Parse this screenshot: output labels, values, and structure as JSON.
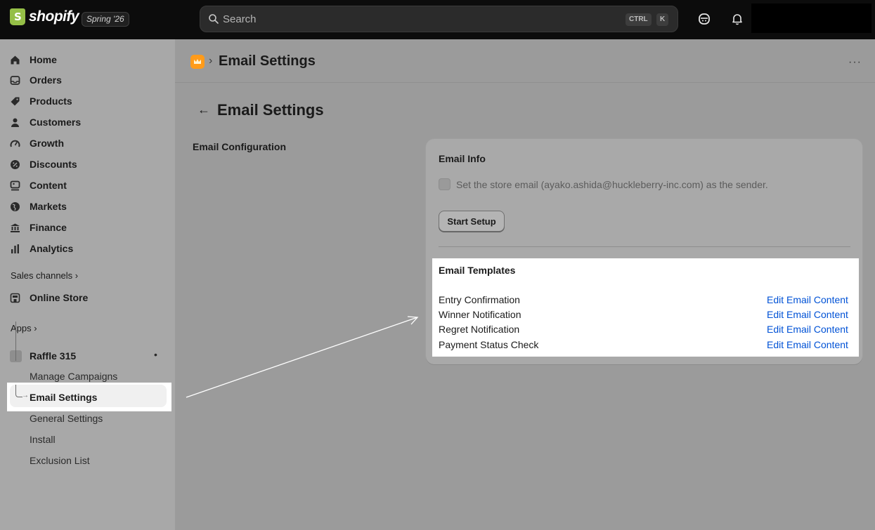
{
  "topbar": {
    "brand": "shopify",
    "edition": "Spring '26",
    "search_placeholder": "Search",
    "shortcut_ctrl": "CTRL",
    "shortcut_key": "K"
  },
  "sidebar": {
    "nav": [
      {
        "label": "Home",
        "icon": "home-icon"
      },
      {
        "label": "Orders",
        "icon": "inbox-icon"
      },
      {
        "label": "Products",
        "icon": "tag-icon"
      },
      {
        "label": "Customers",
        "icon": "person-icon"
      },
      {
        "label": "Growth",
        "icon": "gauge-icon"
      },
      {
        "label": "Discounts",
        "icon": "discount-icon"
      },
      {
        "label": "Content",
        "icon": "content-icon"
      },
      {
        "label": "Markets",
        "icon": "globe-icon"
      },
      {
        "label": "Finance",
        "icon": "bank-icon"
      },
      {
        "label": "Analytics",
        "icon": "bar-chart-icon"
      }
    ],
    "sales_channels_label": "Sales channels ›",
    "online_store": "Online Store",
    "apps_label": "Apps ›",
    "app_name": "Raffle 315",
    "app_dot": "•",
    "app_sub_items": [
      "Manage Campaigns",
      "Email Settings",
      "General Settings",
      "Install",
      "Exclusion List"
    ]
  },
  "header": {
    "crumb_sep": "›",
    "crumb_title": "Email Settings",
    "more": "···"
  },
  "page": {
    "back": "←",
    "title": "Email Settings",
    "section_label": "Email Configuration"
  },
  "card": {
    "title": "Email Info",
    "checkbox_label": "Set the store email (ayako.ashida@huckleberry-inc.com) as the sender.",
    "button": "Start Setup",
    "templates_title": "Email Templates",
    "templates": [
      {
        "name": "Entry Confirmation",
        "action": "Edit Email Content"
      },
      {
        "name": "Winner Notification",
        "action": "Edit Email Content"
      },
      {
        "name": "Regret Notification",
        "action": "Edit Email Content"
      },
      {
        "name": "Payment Status Check",
        "action": "Edit Email Content"
      }
    ]
  },
  "colors": {
    "link": "#0052d6",
    "topbar": "#0c0c0c",
    "overlay": "#9b9b9b",
    "app_accent": "#ff9b1a"
  }
}
